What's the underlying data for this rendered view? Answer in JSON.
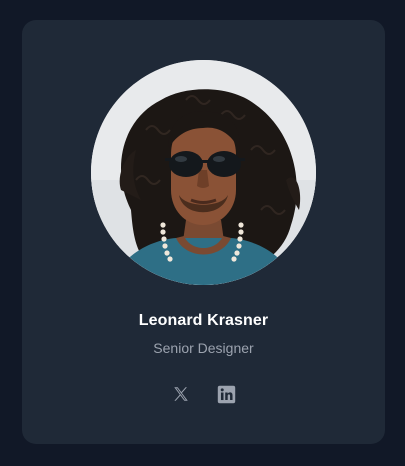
{
  "profile": {
    "name": "Leonard Krasner",
    "role": "Senior Designer",
    "avatar_alt": "Leonard Krasner"
  },
  "socials": [
    {
      "icon": "x-twitter-icon",
      "label": "X"
    },
    {
      "icon": "linkedin-icon",
      "label": "LinkedIn"
    }
  ],
  "colors": {
    "page_background": "#111827",
    "card_background": "#1f2937",
    "name_text": "#ffffff",
    "role_text": "#9ca3af",
    "icon": "#9ca3af"
  }
}
